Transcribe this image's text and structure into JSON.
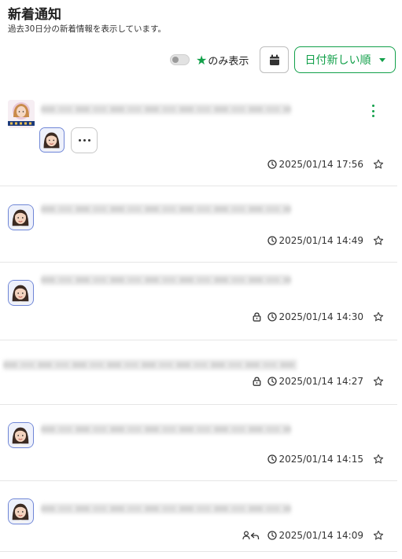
{
  "header": {
    "title": "新着通知",
    "subtitle": "過去30日分の新着情報を表示しています。"
  },
  "toolbar": {
    "star_only_label": "のみ表示",
    "star_only_enabled": false,
    "sort_label": "日付新しい順",
    "accent_color": "#12a04a"
  },
  "notifications": [
    {
      "timestamp": "2025/01/14 17:56",
      "message": "○○○○さんから新着メッセージが届いています。",
      "locked": false,
      "reply": false,
      "has_kebab": true,
      "has_sub_avatar": true
    },
    {
      "timestamp": "2025/01/14 14:49",
      "message": "○○○○さんから新着メッセージが届いています。",
      "locked": false,
      "reply": false
    },
    {
      "timestamp": "2025/01/14 14:30",
      "message": "○○○○さんから新着メッセージが届いています。",
      "locked": true,
      "reply": false
    },
    {
      "timestamp": "2025/01/14 14:27",
      "message": "○○○○さんから新着メッセージが届いています。",
      "locked": true,
      "reply": false,
      "no_avatar": true
    },
    {
      "timestamp": "2025/01/14 14:15",
      "message": "○○○○さんから新着メッセージが届いています。",
      "locked": false,
      "reply": false
    },
    {
      "timestamp": "2025/01/14 14:09",
      "message": "○○○○さんから新着メッセージが届いています。",
      "locked": false,
      "reply": true
    }
  ]
}
